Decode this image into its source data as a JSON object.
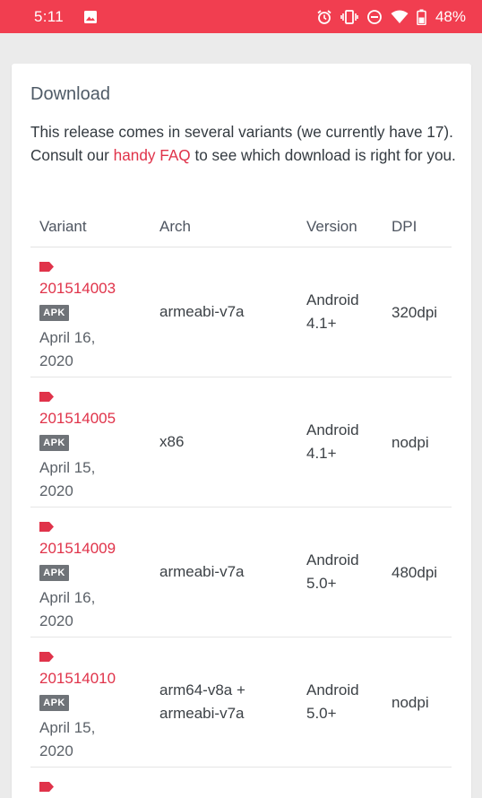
{
  "status_bar": {
    "time": "5:11",
    "battery": "48%",
    "color": "#f13e50"
  },
  "card": {
    "title": "Download",
    "intro_before": "This release comes in several variants (we currently have 17). Consult our ",
    "intro_link": "handy FAQ",
    "intro_after": " to see which download is right for you."
  },
  "table": {
    "headers": [
      "Variant",
      "Arch",
      "Version",
      "DPI"
    ],
    "rows": [
      {
        "variant": "201514003",
        "badge": "APK",
        "date_line1": "April 16,",
        "date_line2": "2020",
        "arch_line1": "armeabi-v7a",
        "arch_line2": "",
        "version_line1": "Android",
        "version_line2": "4.1+",
        "dpi": "320dpi"
      },
      {
        "variant": "201514005",
        "badge": "APK",
        "date_line1": "April 15,",
        "date_line2": "2020",
        "arch_line1": "x86",
        "arch_line2": "",
        "version_line1": "Android",
        "version_line2": "4.1+",
        "dpi": "nodpi"
      },
      {
        "variant": "201514009",
        "badge": "APK",
        "date_line1": "April 16,",
        "date_line2": "2020",
        "arch_line1": "armeabi-v7a",
        "arch_line2": "",
        "version_line1": "Android",
        "version_line2": "5.0+",
        "dpi": "480dpi"
      },
      {
        "variant": "201514010",
        "badge": "APK",
        "date_line1": "April 15,",
        "date_line2": "2020",
        "arch_line1": "arm64-v8a +",
        "arch_line2": "armeabi-v7a",
        "version_line1": "Android",
        "version_line2": "5.0+",
        "dpi": "nodpi"
      }
    ]
  },
  "colors": {
    "accent": "#e0334a",
    "badge": "#6f7378"
  },
  "icons": [
    "image-icon",
    "alarm-icon",
    "vibrate-icon",
    "dnd-icon",
    "wifi-icon",
    "battery-icon",
    "tag-icon"
  ]
}
